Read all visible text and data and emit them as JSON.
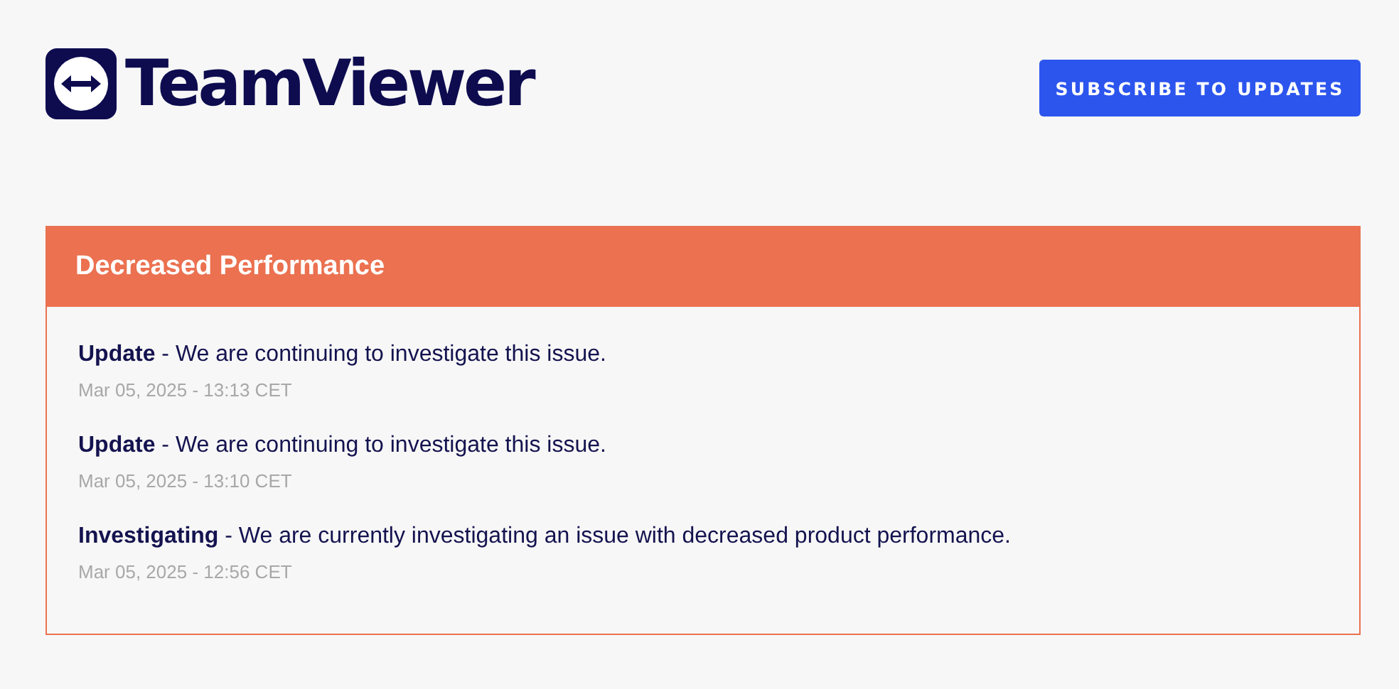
{
  "logo": {
    "text": "TeamViewer"
  },
  "subscribe_button": {
    "label": "SUBSCRIBE TO UPDATES"
  },
  "incident": {
    "title": "Decreased Performance",
    "updates": [
      {
        "message": "**Update** - We are continuing to investigate this issue.",
        "time": "Mar 05, 2025 - 13:13 CET"
      },
      {
        "message": "**Update** - We are continuing to investigate this issue.",
        "time": "Mar 05, 2025 - 13:10 CET"
      },
      {
        "message": "**Investigating** - We are currently investigating an issue with decreased product performance.",
        "time": "Mar 05, 2025 - 12:56 CET"
      }
    ]
  }
}
